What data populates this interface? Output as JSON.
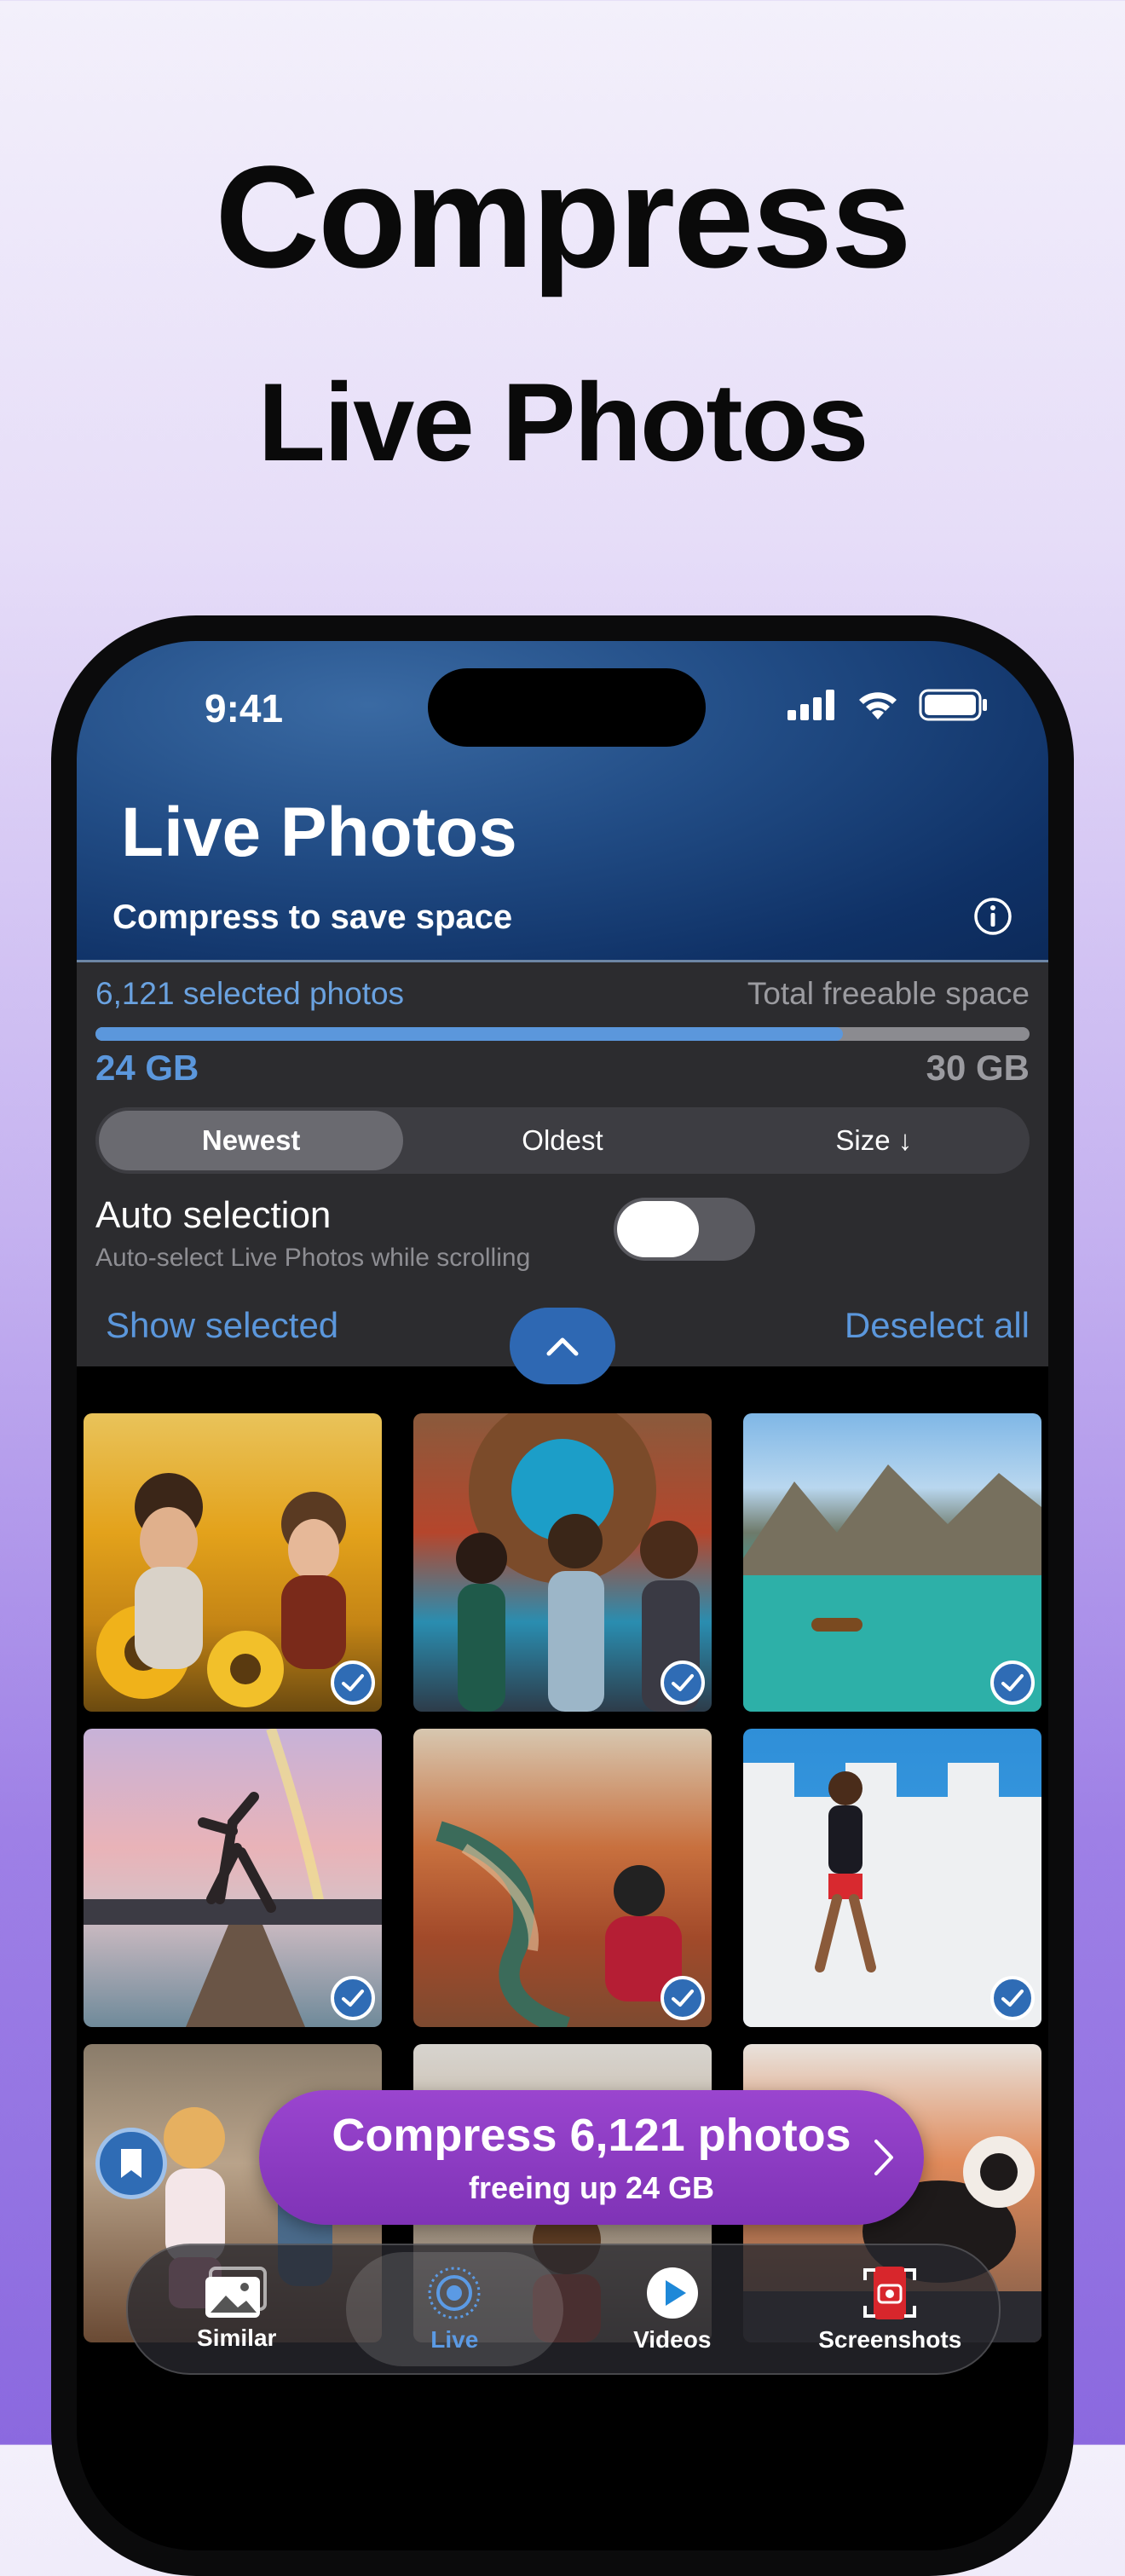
{
  "headline": {
    "line1": "Compress",
    "line2": "Live Photos"
  },
  "status_bar": {
    "time": "9:41",
    "icons": [
      "cellular-icon",
      "wifi-icon",
      "battery-icon"
    ]
  },
  "header": {
    "title": "Live Photos",
    "subtitle": "Compress to save space",
    "info_icon": "info-icon"
  },
  "stats": {
    "selected_label": "6,121 selected photos",
    "total_label": "Total freeable space",
    "selected_size": "24 GB",
    "total_size": "30 GB",
    "progress_fraction": 0.8
  },
  "sort": {
    "options": [
      "Newest",
      "Oldest",
      "Size ↓"
    ],
    "selected": "Newest"
  },
  "auto_selection": {
    "title": "Auto selection",
    "subtitle": "Auto-select Live Photos while scrolling",
    "enabled": false
  },
  "actions": {
    "show_selected": "Show selected",
    "deselect_all": "Deselect all"
  },
  "photos": [
    {
      "subject": "sunflower-field",
      "selected": true
    },
    {
      "subject": "mural-friends",
      "selected": true
    },
    {
      "subject": "mountain-lake",
      "selected": true
    },
    {
      "subject": "pier-dancer",
      "selected": true
    },
    {
      "subject": "canyon-river",
      "selected": true
    },
    {
      "subject": "white-wall-walker",
      "selected": true
    },
    {
      "subject": "children-playing",
      "selected": true
    },
    {
      "subject": "beach-crowd",
      "selected": true
    },
    {
      "subject": "dog-on-table",
      "selected": true
    }
  ],
  "cta": {
    "main": "Compress 6,121 photos",
    "sub": "freeing up 24 GB"
  },
  "tabs": [
    {
      "label": "Similar",
      "icon": "photos-icon",
      "active": false
    },
    {
      "label": "Live",
      "icon": "live-photo-icon",
      "active": true
    },
    {
      "label": "Videos",
      "icon": "play-icon",
      "active": false
    },
    {
      "label": "Screenshots",
      "icon": "screenshot-icon",
      "active": false
    }
  ],
  "colors": {
    "accent": "#5b97dc",
    "header": "#0f3166",
    "cta": "#8a3cc3"
  }
}
